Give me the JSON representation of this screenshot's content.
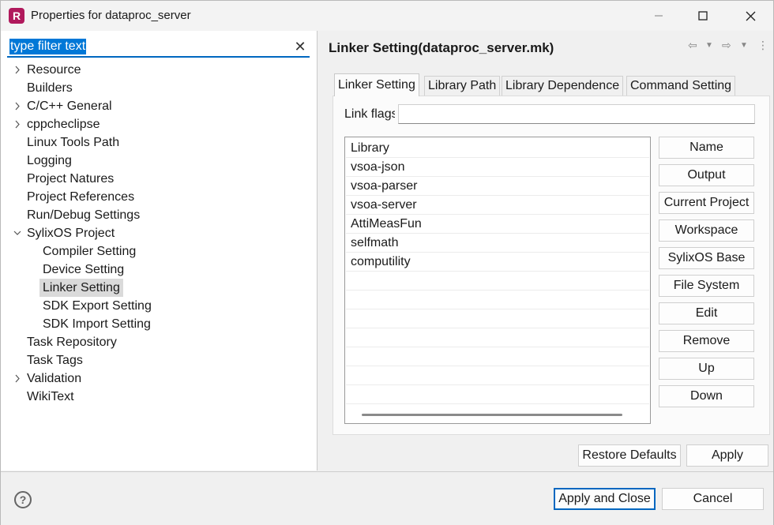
{
  "window": {
    "title": "Properties for dataproc_server",
    "app_icon_letter": "R",
    "app_icon_color": "#b0195c",
    "minimize_icon": "minimize-icon",
    "maximize_icon": "maximize-icon",
    "close_icon": "close-icon"
  },
  "filter": {
    "value": "type filter text",
    "clear_icon": "clear-icon"
  },
  "tree": [
    {
      "label": "Resource",
      "expandable": true,
      "expanded": false,
      "depth": 0
    },
    {
      "label": "Builders",
      "expandable": false,
      "depth": 0
    },
    {
      "label": "C/C++ General",
      "expandable": true,
      "expanded": false,
      "depth": 0
    },
    {
      "label": "cppcheclipse",
      "expandable": true,
      "expanded": false,
      "depth": 0
    },
    {
      "label": "Linux Tools Path",
      "expandable": false,
      "depth": 0
    },
    {
      "label": "Logging",
      "expandable": false,
      "depth": 0
    },
    {
      "label": "Project Natures",
      "expandable": false,
      "depth": 0
    },
    {
      "label": "Project References",
      "expandable": false,
      "depth": 0
    },
    {
      "label": "Run/Debug Settings",
      "expandable": false,
      "depth": 0
    },
    {
      "label": "SylixOS Project",
      "expandable": true,
      "expanded": true,
      "depth": 0
    },
    {
      "label": "Compiler Setting",
      "expandable": false,
      "depth": 1
    },
    {
      "label": "Device Setting",
      "expandable": false,
      "depth": 1
    },
    {
      "label": "Linker Setting",
      "expandable": false,
      "depth": 1,
      "selected": true
    },
    {
      "label": "SDK Export Setting",
      "expandable": false,
      "depth": 1
    },
    {
      "label": "SDK Import Setting",
      "expandable": false,
      "depth": 1
    },
    {
      "label": "Task Repository",
      "expandable": false,
      "depth": 0
    },
    {
      "label": "Task Tags",
      "expandable": false,
      "depth": 0
    },
    {
      "label": "Validation",
      "expandable": true,
      "expanded": false,
      "depth": 0
    },
    {
      "label": "WikiText",
      "expandable": false,
      "depth": 0
    }
  ],
  "page": {
    "title": "Linker Setting(dataproc_server.mk)",
    "nav_icons": [
      "back-arrow-icon",
      "back-dropdown-icon",
      "forward-arrow-icon",
      "forward-dropdown-icon",
      "view-menu-icon"
    ]
  },
  "tabs": [
    {
      "label": "Linker Setting",
      "active": true
    },
    {
      "label": "Library Path",
      "active": false
    },
    {
      "label": "Library Dependence",
      "active": false
    },
    {
      "label": "Command Setting",
      "active": false
    }
  ],
  "link_flags": {
    "label": "Link flags",
    "value": ""
  },
  "libraries": [
    "Library",
    "vsoa-json",
    "vsoa-parser",
    "vsoa-server",
    "AttiMeasFun",
    "selfmath",
    "computility"
  ],
  "side_buttons": [
    "Name",
    "Output",
    "Current Project",
    "Workspace",
    "SylixOS Base",
    "File System",
    "Edit",
    "Remove",
    "Up",
    "Down"
  ],
  "page_buttons": {
    "restore_defaults": "Restore Defaults",
    "apply": "Apply"
  },
  "footer": {
    "help_icon": "help-icon",
    "apply_and_close": "Apply and Close",
    "cancel": "Cancel"
  }
}
